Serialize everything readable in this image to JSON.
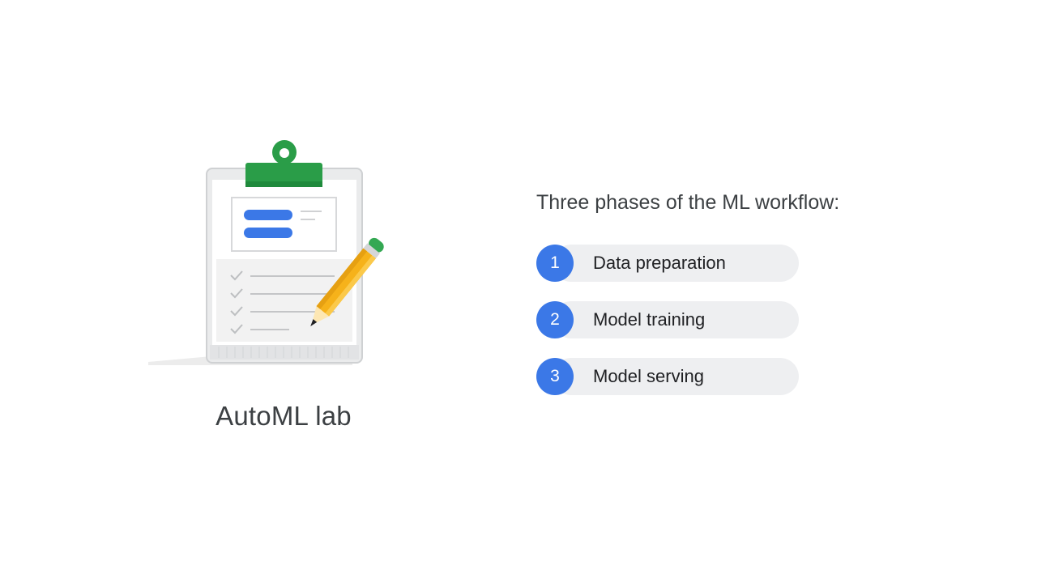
{
  "lab": {
    "title": "AutoML lab",
    "illustration_icon": "clipboard-pencil-icon"
  },
  "workflow": {
    "heading": "Three phases of the ML workflow:",
    "phases": [
      {
        "number": "1",
        "label": "Data preparation"
      },
      {
        "number": "2",
        "label": "Model training"
      },
      {
        "number": "3",
        "label": "Model serving"
      }
    ]
  },
  "colors": {
    "accent_blue": "#3b78e7",
    "clip_green": "#2a9d48",
    "pencil_yellow": "#f6b21a",
    "pill_gray": "#eeeff1",
    "text_dark": "#3c4043"
  }
}
